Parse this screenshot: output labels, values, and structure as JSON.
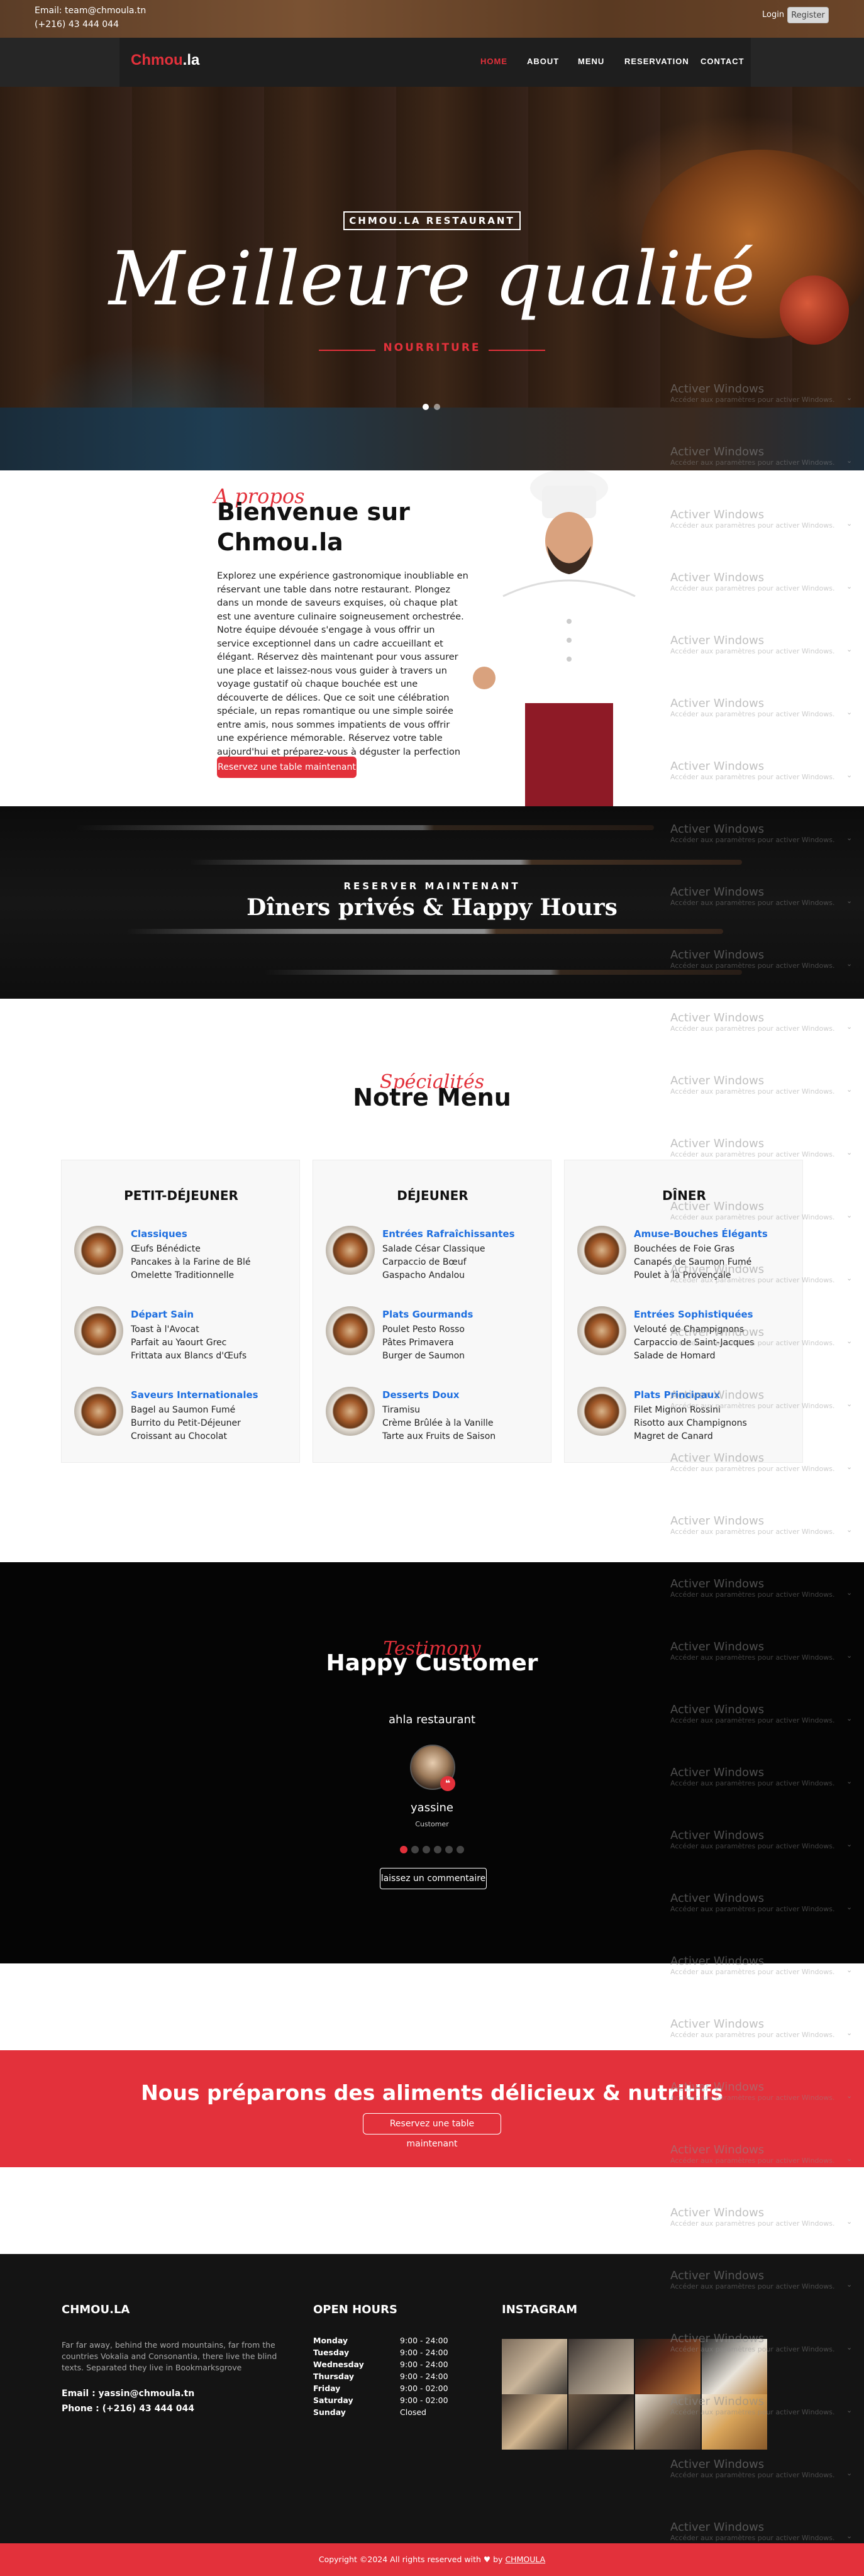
{
  "topbar": {
    "email": "Email: team@chmoula.tn",
    "phone": "(+216) 43 444 044",
    "login": "Login",
    "register": "Register"
  },
  "navbar": {
    "brand": "Chmou",
    "brand_tld": ".la",
    "items": [
      "HOME",
      "ABOUT",
      "MENU",
      "RESERVATION",
      "CONTACT"
    ],
    "active": "HOME"
  },
  "hero": {
    "tagline": "CHMOU.LA RESTAURANT",
    "headline": "Meilleure qualité",
    "sub": "NOURRITURE"
  },
  "about": {
    "script": "A propos",
    "title": "Bienvenue sur Chmou.la",
    "body": "Explorez une expérience gastronomique inoubliable en réservant une table dans notre restaurant. Plongez dans un monde de saveurs exquises, où chaque plat est une aventure culinaire soigneusement orchestrée. Notre équipe dévouée s'engage à vous offrir un service exceptionnel dans un cadre accueillant et élégant. Réservez dès maintenant pour vous assurer une place et laissez-nous vous guider à travers un voyage gustatif où chaque bouchée est une découverte de délices. Que ce soit une célébration spéciale, un repas romantique ou une simple soirée entre amis, nous sommes impatients de vous offrir une expérience mémorable. Réservez votre table aujourd'hui et préparez-vous à déguster la perfection culinaire.",
    "button": "Reservez une table maintenant"
  },
  "dining": {
    "kicker": "RESERVER MAINTENANT",
    "heading": "Dîners privés & Happy Hours"
  },
  "menu": {
    "script": "Spécialités",
    "title": "Notre Menu",
    "cards": [
      {
        "title": "PETIT-DÉJEUNER",
        "groups": [
          {
            "name": "Classiques",
            "dishes": [
              "Œufs Bénédicte",
              "Pancakes à la Farine de Blé",
              "Omelette Traditionnelle"
            ]
          },
          {
            "name": "Départ Sain",
            "dishes": [
              "Toast à l'Avocat",
              "Parfait au Yaourt Grec",
              "Frittata aux Blancs d'Œufs"
            ]
          },
          {
            "name": "Saveurs Internationales",
            "dishes": [
              "Bagel au Saumon Fumé",
              "Burrito du Petit-Déjeuner",
              "Croissant au Chocolat"
            ]
          }
        ]
      },
      {
        "title": "DÉJEUNER",
        "groups": [
          {
            "name": "Entrées Rafraîchissantes",
            "dishes": [
              "Salade César Classique",
              "Carpaccio de Bœuf",
              "Gaspacho Andalou"
            ]
          },
          {
            "name": "Plats Gourmands",
            "dishes": [
              "Poulet Pesto Rosso",
              "Pâtes Primavera",
              "Burger de Saumon"
            ]
          },
          {
            "name": "Desserts Doux",
            "dishes": [
              "Tiramisu",
              "Crème Brûlée à la Vanille",
              "Tarte aux Fruits de Saison"
            ]
          }
        ]
      },
      {
        "title": "DÎNER",
        "groups": [
          {
            "name": "Amuse-Bouches Élégants",
            "dishes": [
              "Bouchées de Foie Gras",
              "Canapés de Saumon Fumé",
              "Poulet à la Provençale"
            ]
          },
          {
            "name": "Entrées Sophistiquées",
            "dishes": [
              "Velouté de Champignons",
              "Carpaccio de Saint-Jacques",
              "Salade de Homard"
            ]
          },
          {
            "name": "Plats Principaux",
            "dishes": [
              "Filet Mignon Rossini",
              "Risotto aux Champignons",
              "Magret de Canard"
            ]
          }
        ]
      }
    ]
  },
  "testimonial": {
    "script": "Testimony",
    "title": "Happy Customer",
    "quote": "ahla restaurant",
    "badge": "❝",
    "name": "yassine",
    "role": "Customer",
    "button": "laissez un commentaire"
  },
  "band": {
    "headline": "Nous préparons des aliments délicieux & nutritifs",
    "button": "Reservez une table maintenant"
  },
  "footer": {
    "col1_title": "CHMOU.LA",
    "col1_text": "Far far away, behind the word mountains, far from the countries Vokalia and Consonantia, there live the blind texts. Separated they live in Bookmarksgrove",
    "email": "Email : yassin@chmoula.tn",
    "phone": "Phone : (+216) 43 444 044",
    "hours_title": "OPEN HOURS",
    "hours": [
      {
        "day": "Monday",
        "time": "9:00 - 24:00"
      },
      {
        "day": "Tuesday",
        "time": "9:00 - 24:00"
      },
      {
        "day": "Wednesday",
        "time": "9:00 - 24:00"
      },
      {
        "day": "Thursday",
        "time": "9:00 - 24:00"
      },
      {
        "day": "Friday",
        "time": "9:00 - 02:00"
      },
      {
        "day": "Saturday",
        "time": "9:00 - 02:00"
      },
      {
        "day": "Sunday",
        "time": "Closed"
      }
    ],
    "insta_title": "INSTAGRAM"
  },
  "copyright": {
    "prefix": "Copyright ©2024 All rights reserved with",
    "heart": "♥",
    "by": "by",
    "link": "CHMOULA"
  },
  "watermark": {
    "title": "Activer Windows",
    "subtitle": "Accéder aux paramètres pour activer Windows."
  },
  "colors": {
    "accent": "#e3313b",
    "link": "#1e6fe0",
    "dark": "#141414"
  }
}
